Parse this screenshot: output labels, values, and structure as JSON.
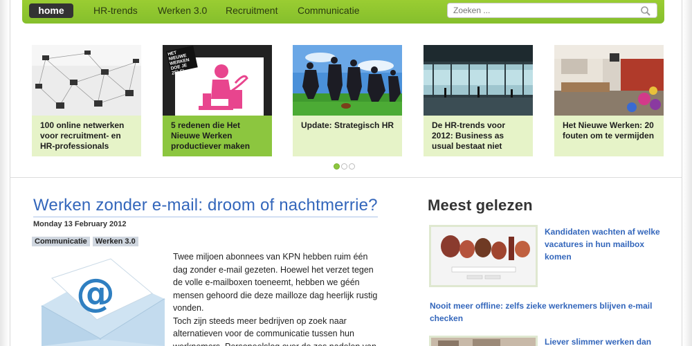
{
  "nav": {
    "home": "home",
    "items": [
      "HR-trends",
      "Werken 3.0",
      "Recruitment",
      "Communicatie"
    ],
    "search_placeholder": "Zoeken ..."
  },
  "carousel": {
    "cards": [
      {
        "text": "100 online netwerken voor recruitment- en HR-professionals",
        "active": false
      },
      {
        "text": "5 redenen die Het Nieuwe Werken productiever maken",
        "active": true
      },
      {
        "text": "Update: Strategisch HR",
        "active": false
      },
      {
        "text": "De HR-trends voor 2012: Business as usual bestaat niet",
        "active": false
      },
      {
        "text": "Het Nieuwe Werken: 20 fouten om te vermijden",
        "active": false
      }
    ],
    "card2_sticker": "HET NIEUWE WERKEN DOE JE ZELF!",
    "dots": 3,
    "active_dot": 0
  },
  "article": {
    "title": "Werken zonder e-mail: droom of nachtmerrie?",
    "date": "Monday 13 February 2012",
    "tags": [
      "Communicatie",
      "Werken 3.0"
    ],
    "body_lines": [
      "Twee miljoen abonnees van KPN hebben ruim één",
      "dag zonder e-mail gezeten. Hoewel het verzet tegen",
      "de volle e-mailboxen toeneemt, hebben we géén",
      "mensen gehoord die deze mailloze dag heerlijk rustig",
      "vonden.",
      "Toch zijn steeds meer bedrijven op zoek naar",
      "alternatieven voor de communicatie tussen hun",
      "werknemers. Personeelslog over de zes nadelen van"
    ]
  },
  "sidebar": {
    "title": "Meest gelezen",
    "items": [
      {
        "lines": [
          "Kandidaten wachten af welke",
          "vacatures in hun mailbox",
          "komen"
        ]
      },
      {
        "lines": [
          "Nooit meer offline: zelfs zieke werknemers blijven e-mail",
          "checken"
        ]
      },
      {
        "lines": [
          "Liever slimmer werken dan"
        ]
      }
    ]
  },
  "colors": {
    "accent": "#8cc63f",
    "link": "#3366bb",
    "nav_dark": "#333333"
  }
}
